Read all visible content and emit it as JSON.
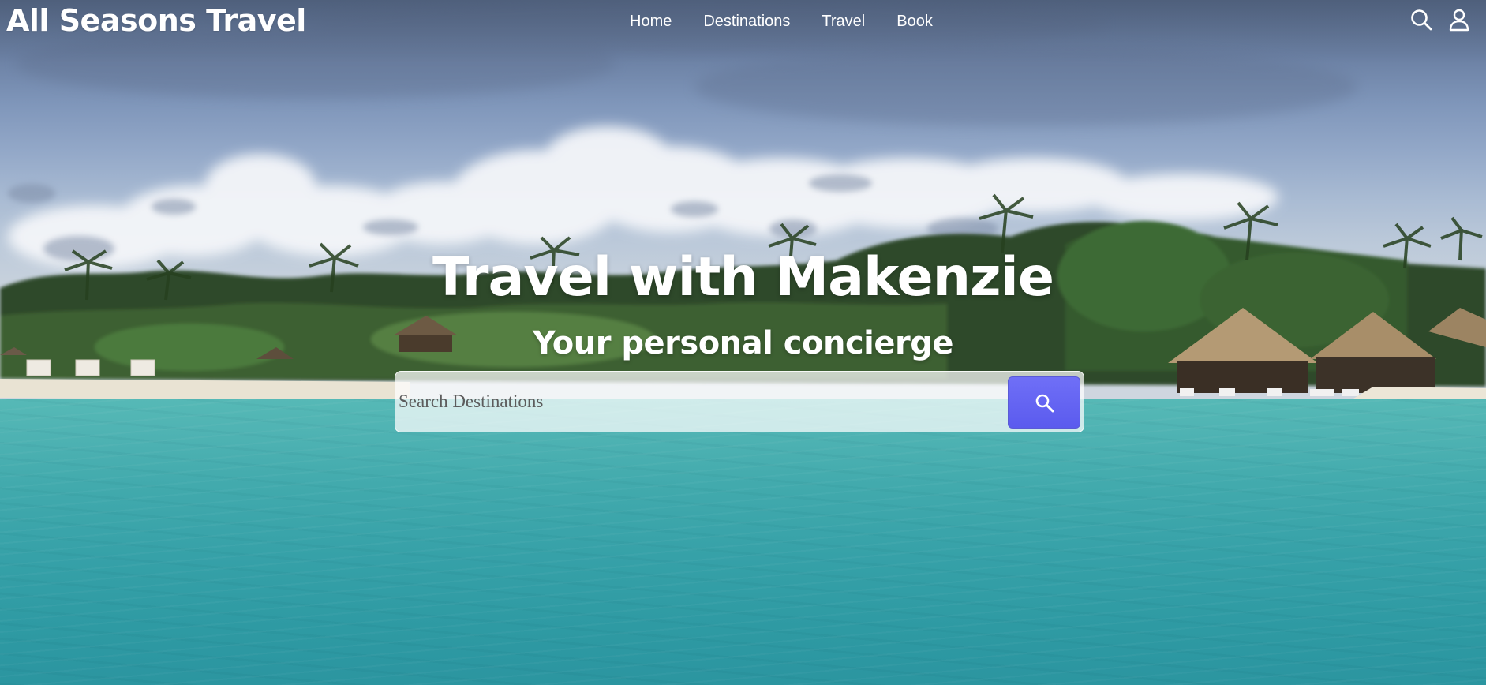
{
  "header": {
    "brand": "All Seasons Travel",
    "nav": [
      {
        "label": "Home"
      },
      {
        "label": "Destinations"
      },
      {
        "label": "Travel"
      },
      {
        "label": "Book"
      }
    ],
    "icons": [
      "search-icon",
      "user-icon"
    ]
  },
  "hero": {
    "title": "Travel with Makenzie",
    "subtitle": "Your personal concierge",
    "search": {
      "placeholder": "Search Destinations",
      "value": "",
      "button_icon": "search-icon"
    },
    "background": "tropical beach with palm trees, thatched huts and turquoise sea"
  },
  "colors": {
    "accent": "#5d5df0",
    "text": "#ffffff",
    "sea": "#3fa8ac",
    "sky": "#8aa0c2"
  }
}
